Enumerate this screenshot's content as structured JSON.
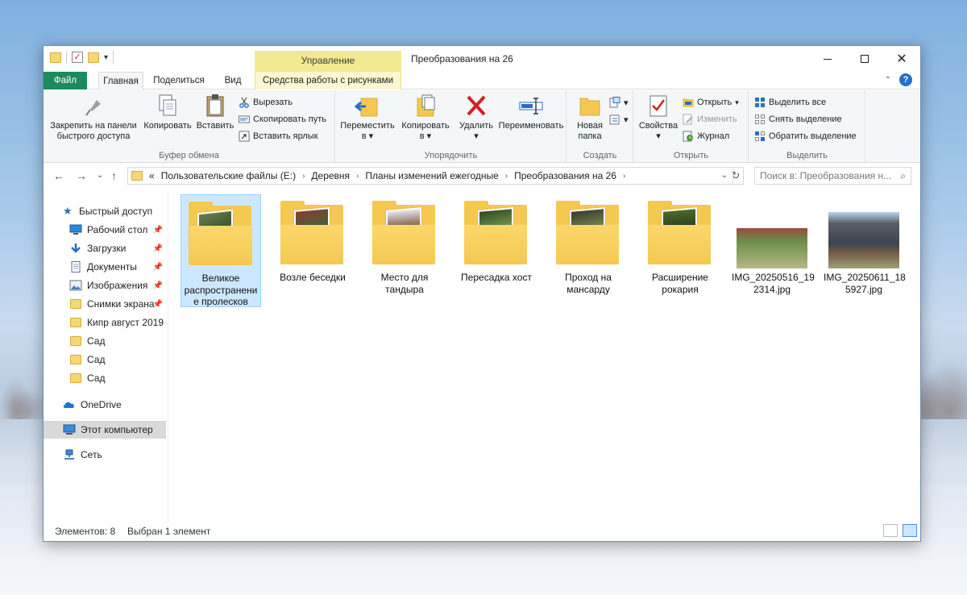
{
  "window": {
    "title": "Преобразования на 26",
    "context_group": "Управление"
  },
  "tabs": {
    "file": "Файл",
    "home": "Главная",
    "share": "Поделиться",
    "view": "Вид",
    "picture_tools": "Средства работы с рисунками"
  },
  "ribbon": {
    "clipboard": {
      "label": "Буфер обмена",
      "pin_line1": "Закрепить на панели",
      "pin_line2": "быстрого доступа",
      "copy": "Копировать",
      "paste": "Вставить",
      "cut": "Вырезать",
      "copy_path": "Скопировать путь",
      "paste_shortcut": "Вставить ярлык"
    },
    "organize": {
      "label": "Упорядочить",
      "move_line1": "Переместить",
      "move_line2": "в",
      "copy_line1": "Копировать",
      "copy_line2": "в",
      "delete": "Удалить",
      "rename": "Переименовать"
    },
    "new": {
      "label": "Создать",
      "new_folder_line1": "Новая",
      "new_folder_line2": "папка"
    },
    "open": {
      "label": "Открыть",
      "properties": "Свойства",
      "open": "Открыть",
      "edit": "Изменить",
      "history": "Журнал"
    },
    "select": {
      "label": "Выделить",
      "select_all": "Выделить все",
      "select_none": "Снять выделение",
      "invert": "Обратить выделение"
    }
  },
  "address": {
    "overflow": "«",
    "crumbs": [
      "Пользовательские файлы (E:)",
      "Деревня",
      "Планы изменений ежегодные",
      "Преобразования на 26"
    ],
    "search_placeholder": "Поиск в: Преобразования н..."
  },
  "navpane": {
    "quick_access": "Быстрый доступ",
    "pinned": [
      {
        "label": "Рабочий стол",
        "icon": "desktop-icon"
      },
      {
        "label": "Загрузки",
        "icon": "download-icon"
      },
      {
        "label": "Документы",
        "icon": "documents-icon"
      },
      {
        "label": "Изображения",
        "icon": "pictures-icon"
      },
      {
        "label": "Снимки экрана",
        "icon": "folder-icon"
      }
    ],
    "folders": [
      "Кипр август 2019",
      "Сад",
      "Сад",
      "Сад"
    ],
    "onedrive": "OneDrive",
    "this_pc": "Этот компьютер",
    "network": "Сеть"
  },
  "items": [
    {
      "name": "Великое распространение пролесков",
      "type": "folder",
      "selected": true
    },
    {
      "name": "Возле беседки",
      "type": "folder"
    },
    {
      "name": "Место для тандыра",
      "type": "folder"
    },
    {
      "name": "Пересадка хост",
      "type": "folder"
    },
    {
      "name": "Проход на мансарду",
      "type": "folder"
    },
    {
      "name": "Расширение рокария",
      "type": "folder"
    },
    {
      "name": "IMG_20250516_192314.jpg",
      "type": "image"
    },
    {
      "name": "IMG_20250611_185927.jpg",
      "type": "image"
    }
  ],
  "tile_labels": [
    [
      "Великое",
      "распространени",
      "е пролесков"
    ],
    [
      "Возле беседки"
    ],
    [
      "Место для",
      "тандыра"
    ],
    [
      "Пересадка хост"
    ],
    [
      "Проход на",
      "мансарду"
    ],
    [
      "Расширение",
      "рокария"
    ],
    [
      "IMG_20250516_19",
      "2314.jpg"
    ],
    [
      "IMG_20250611_18",
      "5927.jpg"
    ]
  ],
  "status": {
    "count": "Элементов: 8",
    "selected": "Выбран 1 элемент"
  },
  "colors": {
    "file_tab": "#1a8a5f",
    "context_tab": "#f2ea91",
    "selection": "#cce8ff",
    "folder": "#f5c852"
  }
}
